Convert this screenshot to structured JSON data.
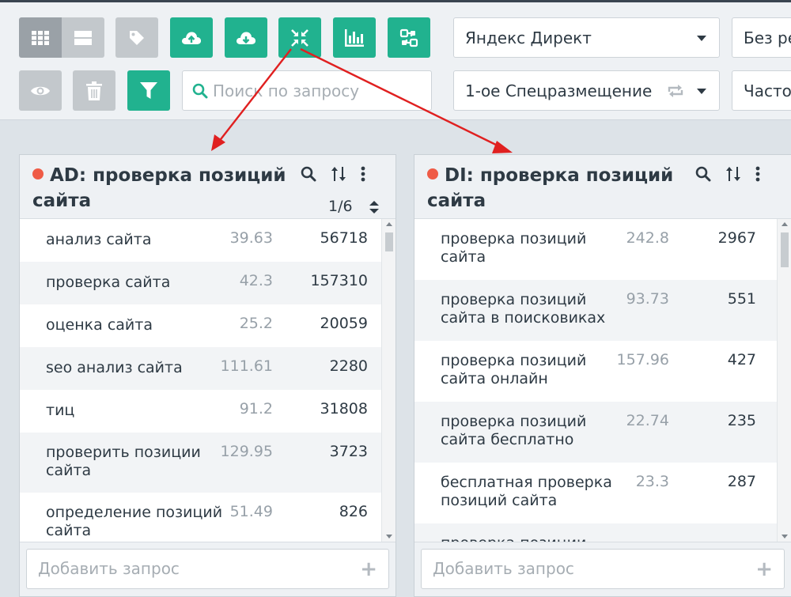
{
  "toolbar": {
    "buttons": [
      {
        "name": "grid-view-button",
        "icon": "grid-icon",
        "tone": "dark"
      },
      {
        "name": "list-view-button",
        "icon": "list-icon",
        "tone": "gray"
      },
      {
        "name": "tag-button",
        "icon": "tag-icon",
        "tone": "gray"
      },
      {
        "name": "upload-button",
        "icon": "cloud-upload-icon",
        "tone": "green"
      },
      {
        "name": "download-button",
        "icon": "cloud-download-icon",
        "tone": "green"
      },
      {
        "name": "collapse-button",
        "icon": "collapse-arrows-icon",
        "tone": "green"
      },
      {
        "name": "chart-button",
        "icon": "bar-chart-icon",
        "tone": "green"
      },
      {
        "name": "cluster-button",
        "icon": "cluster-icon",
        "tone": "green"
      },
      {
        "name": "view-button",
        "icon": "eye-icon",
        "tone": "gray"
      },
      {
        "name": "delete-button",
        "icon": "trash-icon",
        "tone": "gray"
      },
      {
        "name": "filter-button",
        "icon": "filter-icon",
        "tone": "green"
      }
    ],
    "search_placeholder": "Поиск по запросу",
    "source_select": "Яндекс Директ",
    "region_select": "Без ре",
    "position_select": "1-ое Спецразмещение",
    "frequency_select": "Часто"
  },
  "colors": {
    "accent": "#21b28f",
    "status_dot": "#ef5b46",
    "annotation_arrow": "#e02020"
  },
  "panels": [
    {
      "title": "AD: проверка позиций сайта",
      "pager": "1/6",
      "rows": [
        {
          "keyword": "анализ сайта",
          "v1": "39.63",
          "v2": "56718"
        },
        {
          "keyword": "проверка сайта",
          "v1": "42.3",
          "v2": "157310"
        },
        {
          "keyword": "оценка сайта",
          "v1": "25.2",
          "v2": "20059"
        },
        {
          "keyword": "seo анализ сайта",
          "v1": "111.61",
          "v2": "2280"
        },
        {
          "keyword": "тиц",
          "v1": "91.2",
          "v2": "31808"
        },
        {
          "keyword": "проверить позиции сайта",
          "v1": "129.95",
          "v2": "3723"
        },
        {
          "keyword": "определение позиций сайта",
          "v1": "51.49",
          "v2": "826"
        }
      ],
      "add_placeholder": "Добавить запрос"
    },
    {
      "title": "DI: проверка позиций сайта",
      "rows": [
        {
          "keyword": "проверка позиций сайта",
          "v1": "242.8",
          "v2": "2967"
        },
        {
          "keyword": "проверка позиций сайта в поисковиках",
          "v1": "93.73",
          "v2": "551"
        },
        {
          "keyword": "проверка позиций сайта онлайн",
          "v1": "157.96",
          "v2": "427"
        },
        {
          "keyword": "проверка позиций сайта бесплатно",
          "v1": "22.74",
          "v2": "235"
        },
        {
          "keyword": "бесплатная проверка позиций сайта",
          "v1": "23.3",
          "v2": "287"
        },
        {
          "keyword": "проверка позиции",
          "v1": "",
          "v2": ""
        }
      ],
      "add_placeholder": "Добавить запрос"
    }
  ]
}
